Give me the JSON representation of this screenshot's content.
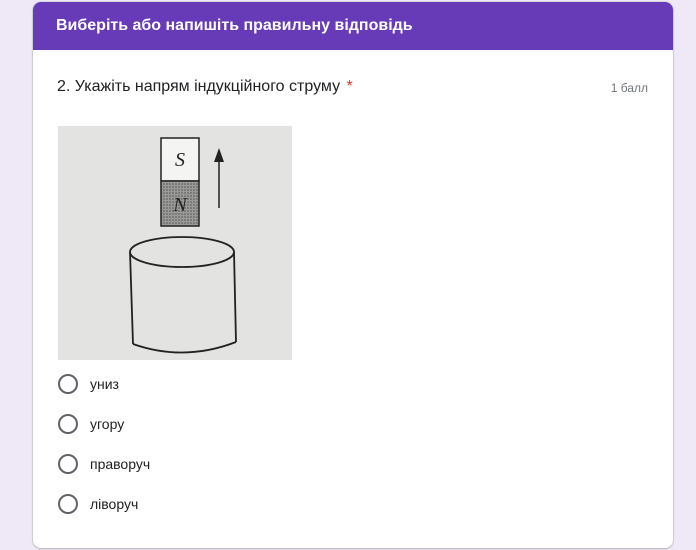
{
  "section": {
    "title": "Виберіть або напишіть правильну відповідь"
  },
  "question": {
    "title": "2. Укажіть напрям індукційного струму",
    "required_mark": "*",
    "points": "1 балл",
    "image": {
      "magnet_top_label": "S",
      "magnet_bottom_label": "N"
    },
    "options": [
      {
        "label": "униз"
      },
      {
        "label": "угору"
      },
      {
        "label": "праворуч"
      },
      {
        "label": "ліворуч"
      }
    ]
  },
  "colors": {
    "header": "#673ab7",
    "background": "#efe9f7",
    "required": "#d93025"
  }
}
